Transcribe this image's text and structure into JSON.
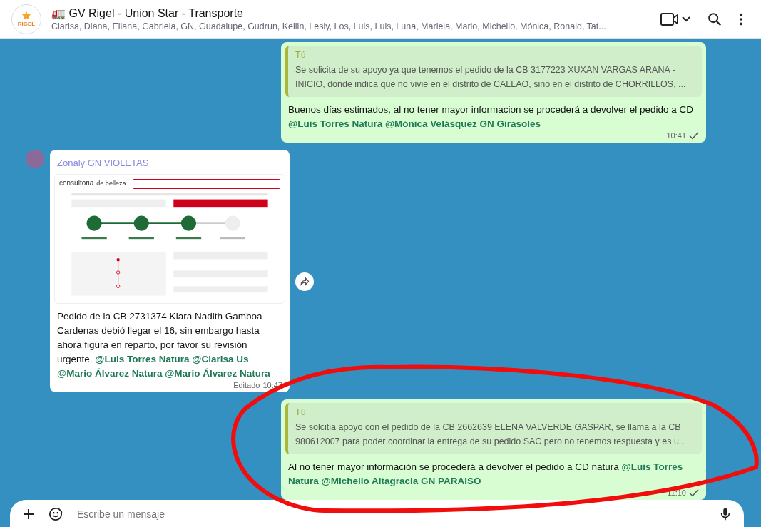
{
  "header": {
    "logo_text": "RIGEL",
    "title": "🚛 GV Rigel - Union Star - Transporte",
    "members": "Clarisa, Diana, Eliana, Gabriela, GN, Guadalupe, Gudrun, Kellin, Lesly, Los, Luis, Luis, Luna, Mariela, Mario, Michello, Mónica, Ronald, Tat..."
  },
  "messages": [
    {
      "kind": "outgoing",
      "quote": {
        "author": "Tú",
        "text": "Se solicita de su apoyo ya que tenemos el pedido de la CB 3177223 XUXAN VARGAS ARANA - INICIO, donde indica que no vivie en el distrito de CALLAO, sino en el distrito de CHORRILLOS, ..."
      },
      "text": "Buenos días estimados, al no tener mayor informacion se procederá a devolver el pedido a CD **@Luis Torres Natura @Mónica Velásquez GN Girasoles**",
      "time": "10:41",
      "read": false
    },
    {
      "kind": "incoming",
      "author": "Zonaly GN VIOLETAS",
      "image": {
        "logo_text": "consultoria",
        "logo_subtext": "de belleza"
      },
      "text": "Pedido de la CB 2731374 Kiara Nadith Gamboa Cardenas debió llegar el 16, sin embargo hasta ahora figura en reparto, por favor su revisión urgente. **@Luis Torres Natura @Clarisa Us @Mario Álvarez Natura @Mario Álvarez Natura**",
      "edited": "Editado",
      "time": "10:47"
    },
    {
      "kind": "outgoing",
      "quote": {
        "author": "Tú",
        "text": "Se solcitia apoyo con el pedido de la CB 2662639 ELENA VALVERDE GASPAR, se llama a la CB 980612007 para poder coordinar la entrega de su pedido SAC pero no tenemos respuesta y es u..."
      },
      "text": "Al no tener mayor información se procederá a devolver el pedido a CD natura **@Luis Torres Natura @Michello Altagracia GN PARAISO**",
      "time": "11:10",
      "read": false
    }
  ],
  "composer": {
    "placeholder": "Escribe un mensaje"
  }
}
